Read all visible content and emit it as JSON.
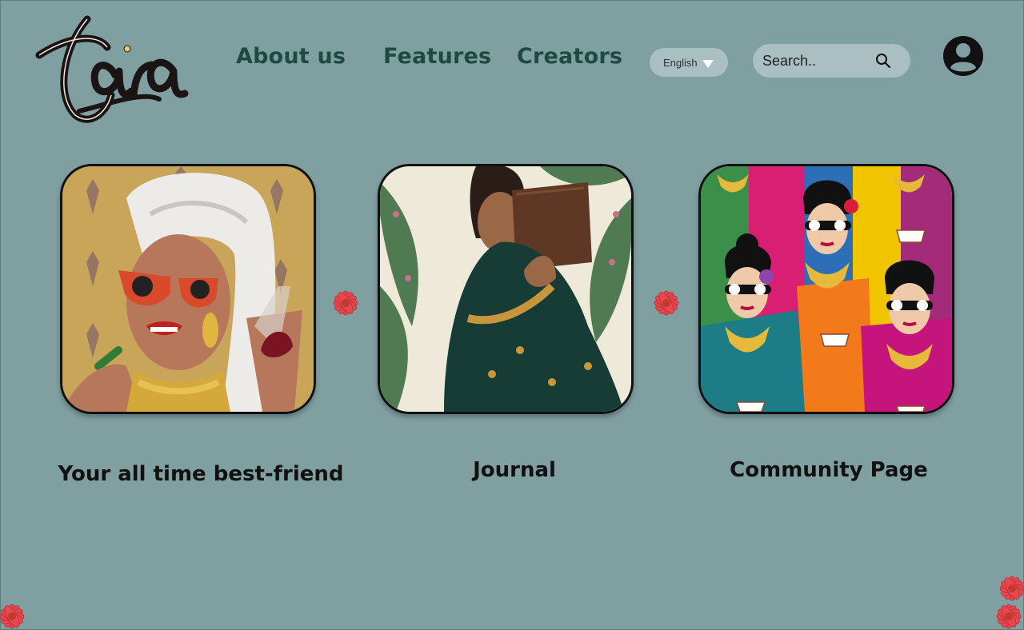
{
  "brand": {
    "logo_text": "tara"
  },
  "nav": {
    "links": [
      {
        "label": "About us"
      },
      {
        "label": "Features"
      },
      {
        "label": "Creators"
      }
    ]
  },
  "language": {
    "selected": "English"
  },
  "search": {
    "placeholder": "Search.."
  },
  "cards": [
    {
      "caption": "Your all time best-friend"
    },
    {
      "caption": "Journal"
    },
    {
      "caption": "Community Page"
    }
  ],
  "colors": {
    "background": "#7f9fa1",
    "nav_text": "#1e4a40",
    "pill": "#a9bfc1",
    "flower": "#e8474f"
  }
}
